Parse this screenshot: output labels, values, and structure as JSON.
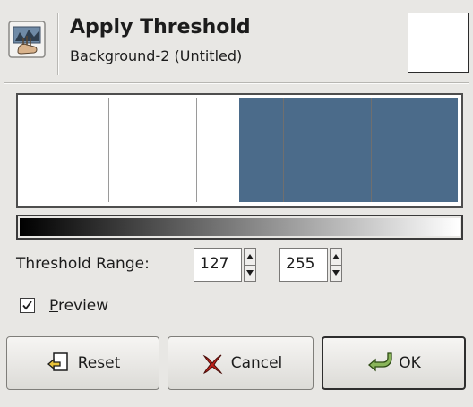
{
  "dialog": {
    "title": "Apply Threshold",
    "subtitle": "Background-2 (Untitled)",
    "icon": "threshold-tool-icon"
  },
  "histogram": {
    "channel_min": 0,
    "channel_max": 255,
    "selection_low": 127,
    "selection_high": 255,
    "gridlines": [
      51,
      102,
      153,
      204
    ],
    "selection_color": "#4b6b8a",
    "gradient": [
      "#000000",
      "#ffffff"
    ]
  },
  "threshold": {
    "label": "Threshold Range:",
    "low": "127",
    "high": "255"
  },
  "preview": {
    "label": "Preview",
    "checked": true
  },
  "buttons": {
    "reset": {
      "label": "Reset",
      "icon": "reset-icon"
    },
    "cancel": {
      "label": "Cancel",
      "icon": "cancel-icon"
    },
    "ok": {
      "label": "OK",
      "icon": "ok-icon"
    }
  }
}
